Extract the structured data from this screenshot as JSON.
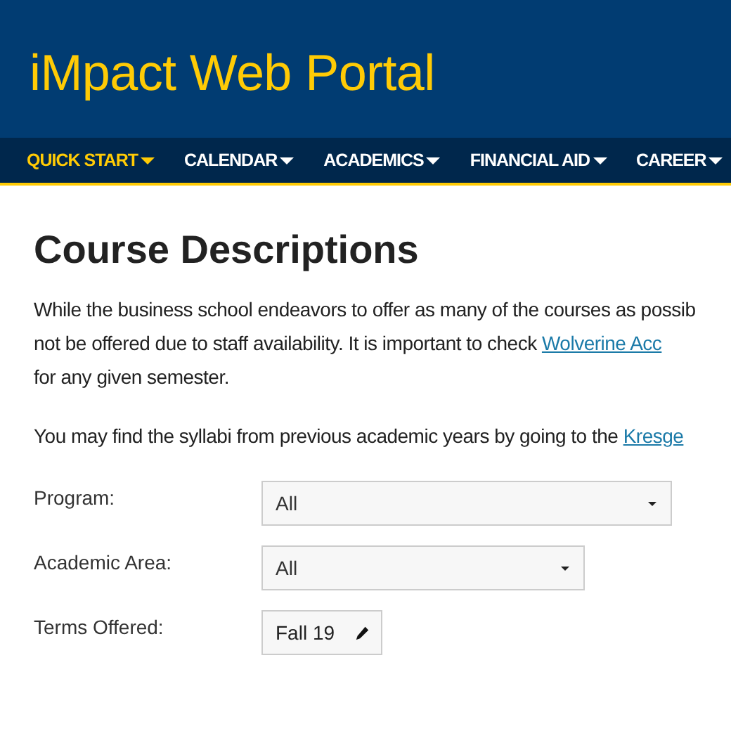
{
  "site_title": "iMpact Web Portal",
  "nav": [
    {
      "label": "QUICK START",
      "selected": true
    },
    {
      "label": "CALENDAR",
      "selected": false
    },
    {
      "label": "ACADEMICS",
      "selected": false
    },
    {
      "label": "FINANCIAL AID",
      "selected": false
    },
    {
      "label": "CAREER",
      "selected": false
    }
  ],
  "heading": "Course Descriptions",
  "paragraphs": [
    [
      {
        "text": "While the business school endeavors to offer as many of the courses as possib"
      },
      {
        "text": "not be offered due to staff availability. It is important to check ",
        "link": "Wolverine Acc"
      },
      {
        "text": "for any given semester."
      }
    ],
    [
      {
        "text": "You may find the syllabi from previous academic years by going to the ",
        "link": "Kresge"
      }
    ]
  ],
  "filters": [
    {
      "label": "Program:",
      "kind": "select",
      "value": "All"
    },
    {
      "label": "Academic Area:",
      "kind": "select",
      "value": "All"
    },
    {
      "label": "Terms Offered:",
      "kind": "edit",
      "value": "Fall 19"
    }
  ]
}
